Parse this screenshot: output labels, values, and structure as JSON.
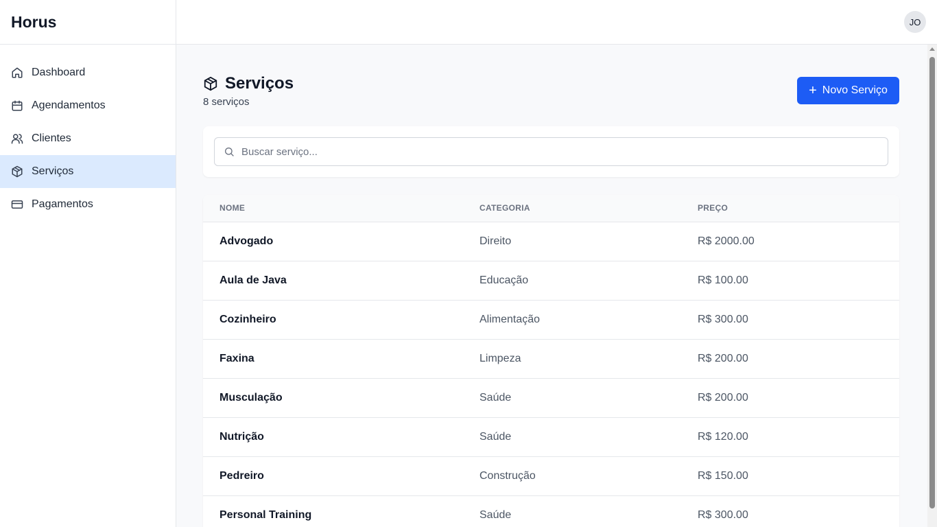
{
  "app": {
    "brand": "Horus"
  },
  "sidebar": {
    "items": [
      {
        "label": "Dashboard",
        "icon": "home-icon",
        "active": false
      },
      {
        "label": "Agendamentos",
        "icon": "calendar-icon",
        "active": false
      },
      {
        "label": "Clientes",
        "icon": "users-icon",
        "active": false
      },
      {
        "label": "Serviços",
        "icon": "package-icon",
        "active": true
      },
      {
        "label": "Pagamentos",
        "icon": "credit-card-icon",
        "active": false
      }
    ]
  },
  "topbar": {
    "avatar_initials": "JO"
  },
  "page": {
    "title": "Serviços",
    "subtitle": "8 serviços",
    "new_button_label": "Novo Serviço"
  },
  "search": {
    "placeholder": "Buscar serviço...",
    "value": ""
  },
  "table": {
    "columns": [
      "NOME",
      "CATEGORIA",
      "PREÇO"
    ],
    "rows": [
      {
        "name": "Advogado",
        "category": "Direito",
        "price": "R$ 2000.00"
      },
      {
        "name": "Aula de Java",
        "category": "Educação",
        "price": "R$ 100.00"
      },
      {
        "name": "Cozinheiro",
        "category": "Alimentação",
        "price": "R$ 300.00"
      },
      {
        "name": "Faxina",
        "category": "Limpeza",
        "price": "R$ 200.00"
      },
      {
        "name": "Musculação",
        "category": "Saúde",
        "price": "R$ 200.00"
      },
      {
        "name": "Nutrição",
        "category": "Saúde",
        "price": "R$ 120.00"
      },
      {
        "name": "Pedreiro",
        "category": "Construção",
        "price": "R$ 150.00"
      },
      {
        "name": "Personal Training",
        "category": "Saúde",
        "price": "R$ 300.00"
      }
    ]
  },
  "colors": {
    "accent": "#1d5cf5",
    "active_nav_bg": "#dbeafe",
    "page_bg": "#f8f9fb"
  }
}
